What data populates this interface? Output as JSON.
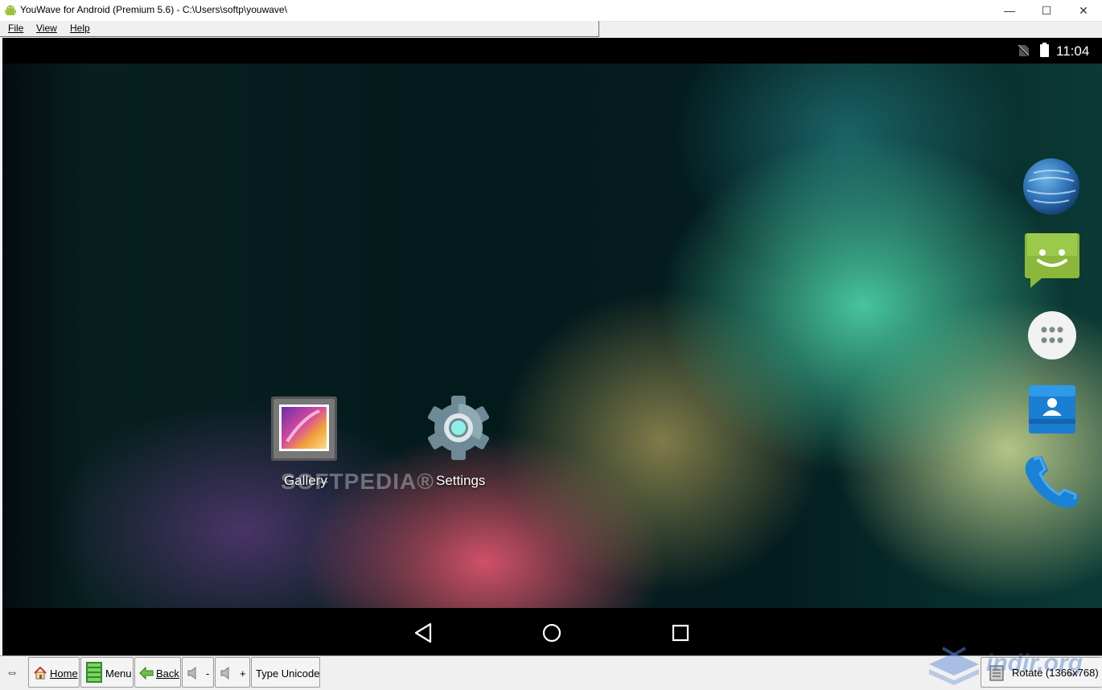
{
  "window": {
    "title": "YouWave for Android (Premium 5.6) - C:\\Users\\softp\\youwave\\",
    "controls": {
      "minimize": "—",
      "maximize": "☐",
      "close": "✕"
    }
  },
  "menubar": {
    "items": [
      "File",
      "View",
      "Help"
    ]
  },
  "status_bar": {
    "time": "11:04",
    "icons": [
      "no-sim-icon",
      "battery-icon"
    ]
  },
  "desktop": {
    "icons": [
      {
        "label": "Gallery",
        "icon": "gallery-icon"
      },
      {
        "label": "Settings",
        "icon": "settings-icon"
      }
    ],
    "watermark": "SOFTPEDIA®"
  },
  "dock": {
    "icons": [
      "browser-icon",
      "messaging-icon",
      "app-drawer-icon",
      "contacts-icon",
      "phone-icon"
    ]
  },
  "navbar": {
    "buttons": [
      "back-icon",
      "home-icon",
      "recents-icon"
    ]
  },
  "toolbar": {
    "resize_symbol": "⇔",
    "home": "Home",
    "menu": "Menu",
    "back": "Back",
    "vol_down": "-",
    "vol_up": "+",
    "type_unicode": "Type Unicode",
    "rotate": "Rotate (1366x768)",
    "brand": "indir.org"
  },
  "colors": {
    "titlebar": "#ffffff",
    "android_bg": "#000000",
    "toolbar_bg": "#f0f0f0"
  }
}
